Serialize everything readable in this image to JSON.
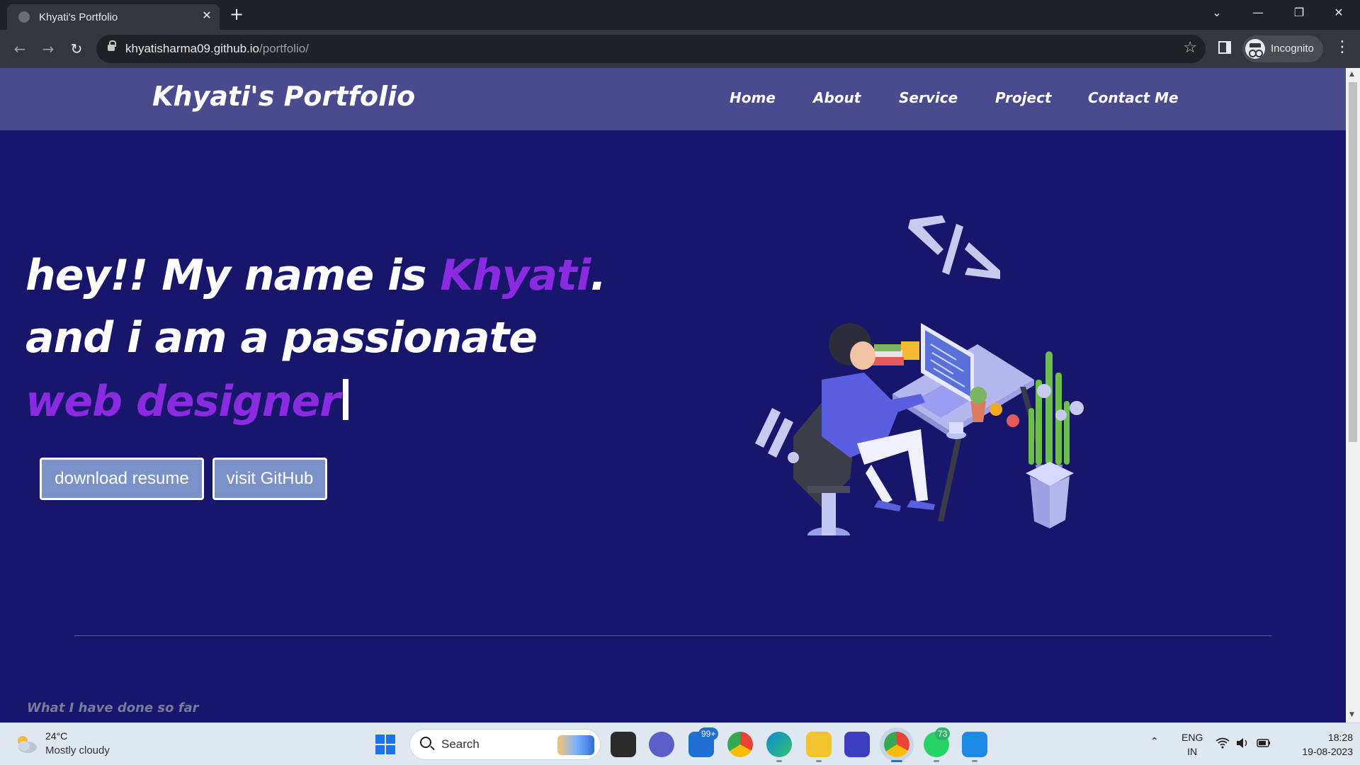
{
  "browser": {
    "tab_title": "Khyati's Portfolio",
    "url_host": "khyatisharma09.github.io",
    "url_path": "/portfolio/",
    "profile_label": "Incognito",
    "tab_close_glyph": "✕",
    "new_tab_glyph": "+",
    "back_glyph": "←",
    "forward_glyph": "→",
    "reload_glyph": "↻",
    "star_glyph": "☆",
    "menu_glyph": "⋮",
    "tab_list_glyph": "⌄",
    "minimize_glyph": "—",
    "restore_glyph": "❐",
    "close_glyph": "✕"
  },
  "site": {
    "brand": "Khyati's Portfolio",
    "nav": [
      "Home",
      "About",
      "Service",
      "Project",
      "Contact Me"
    ],
    "hero": {
      "line1_prefix": "hey!! My name is ",
      "line1_name": "Khyati",
      "line1_suffix": ".",
      "line2": "and i am a passionate",
      "line3": "web designer"
    },
    "buttons": {
      "resume": "download resume",
      "github": "visit GitHub"
    },
    "section_subheading": "What I have done so far"
  },
  "taskbar": {
    "weather_temp": "24°C",
    "weather_desc": "Mostly cloudy",
    "search_label": "Search",
    "mail_badge": "99+",
    "whatsapp_badge": "73",
    "lang_line1": "ENG",
    "lang_line2": "IN",
    "time": "18:28",
    "date": "19-08-2023",
    "tray_chevron_glyph": "⌃"
  },
  "colors": {
    "page_bg": "#17166a",
    "nav_bg": "#4a4b8f",
    "accent_purple": "#8a2be2",
    "button_bg": "#7a92c7"
  },
  "icons": {
    "illustration": "developer-at-desk-illustration"
  }
}
